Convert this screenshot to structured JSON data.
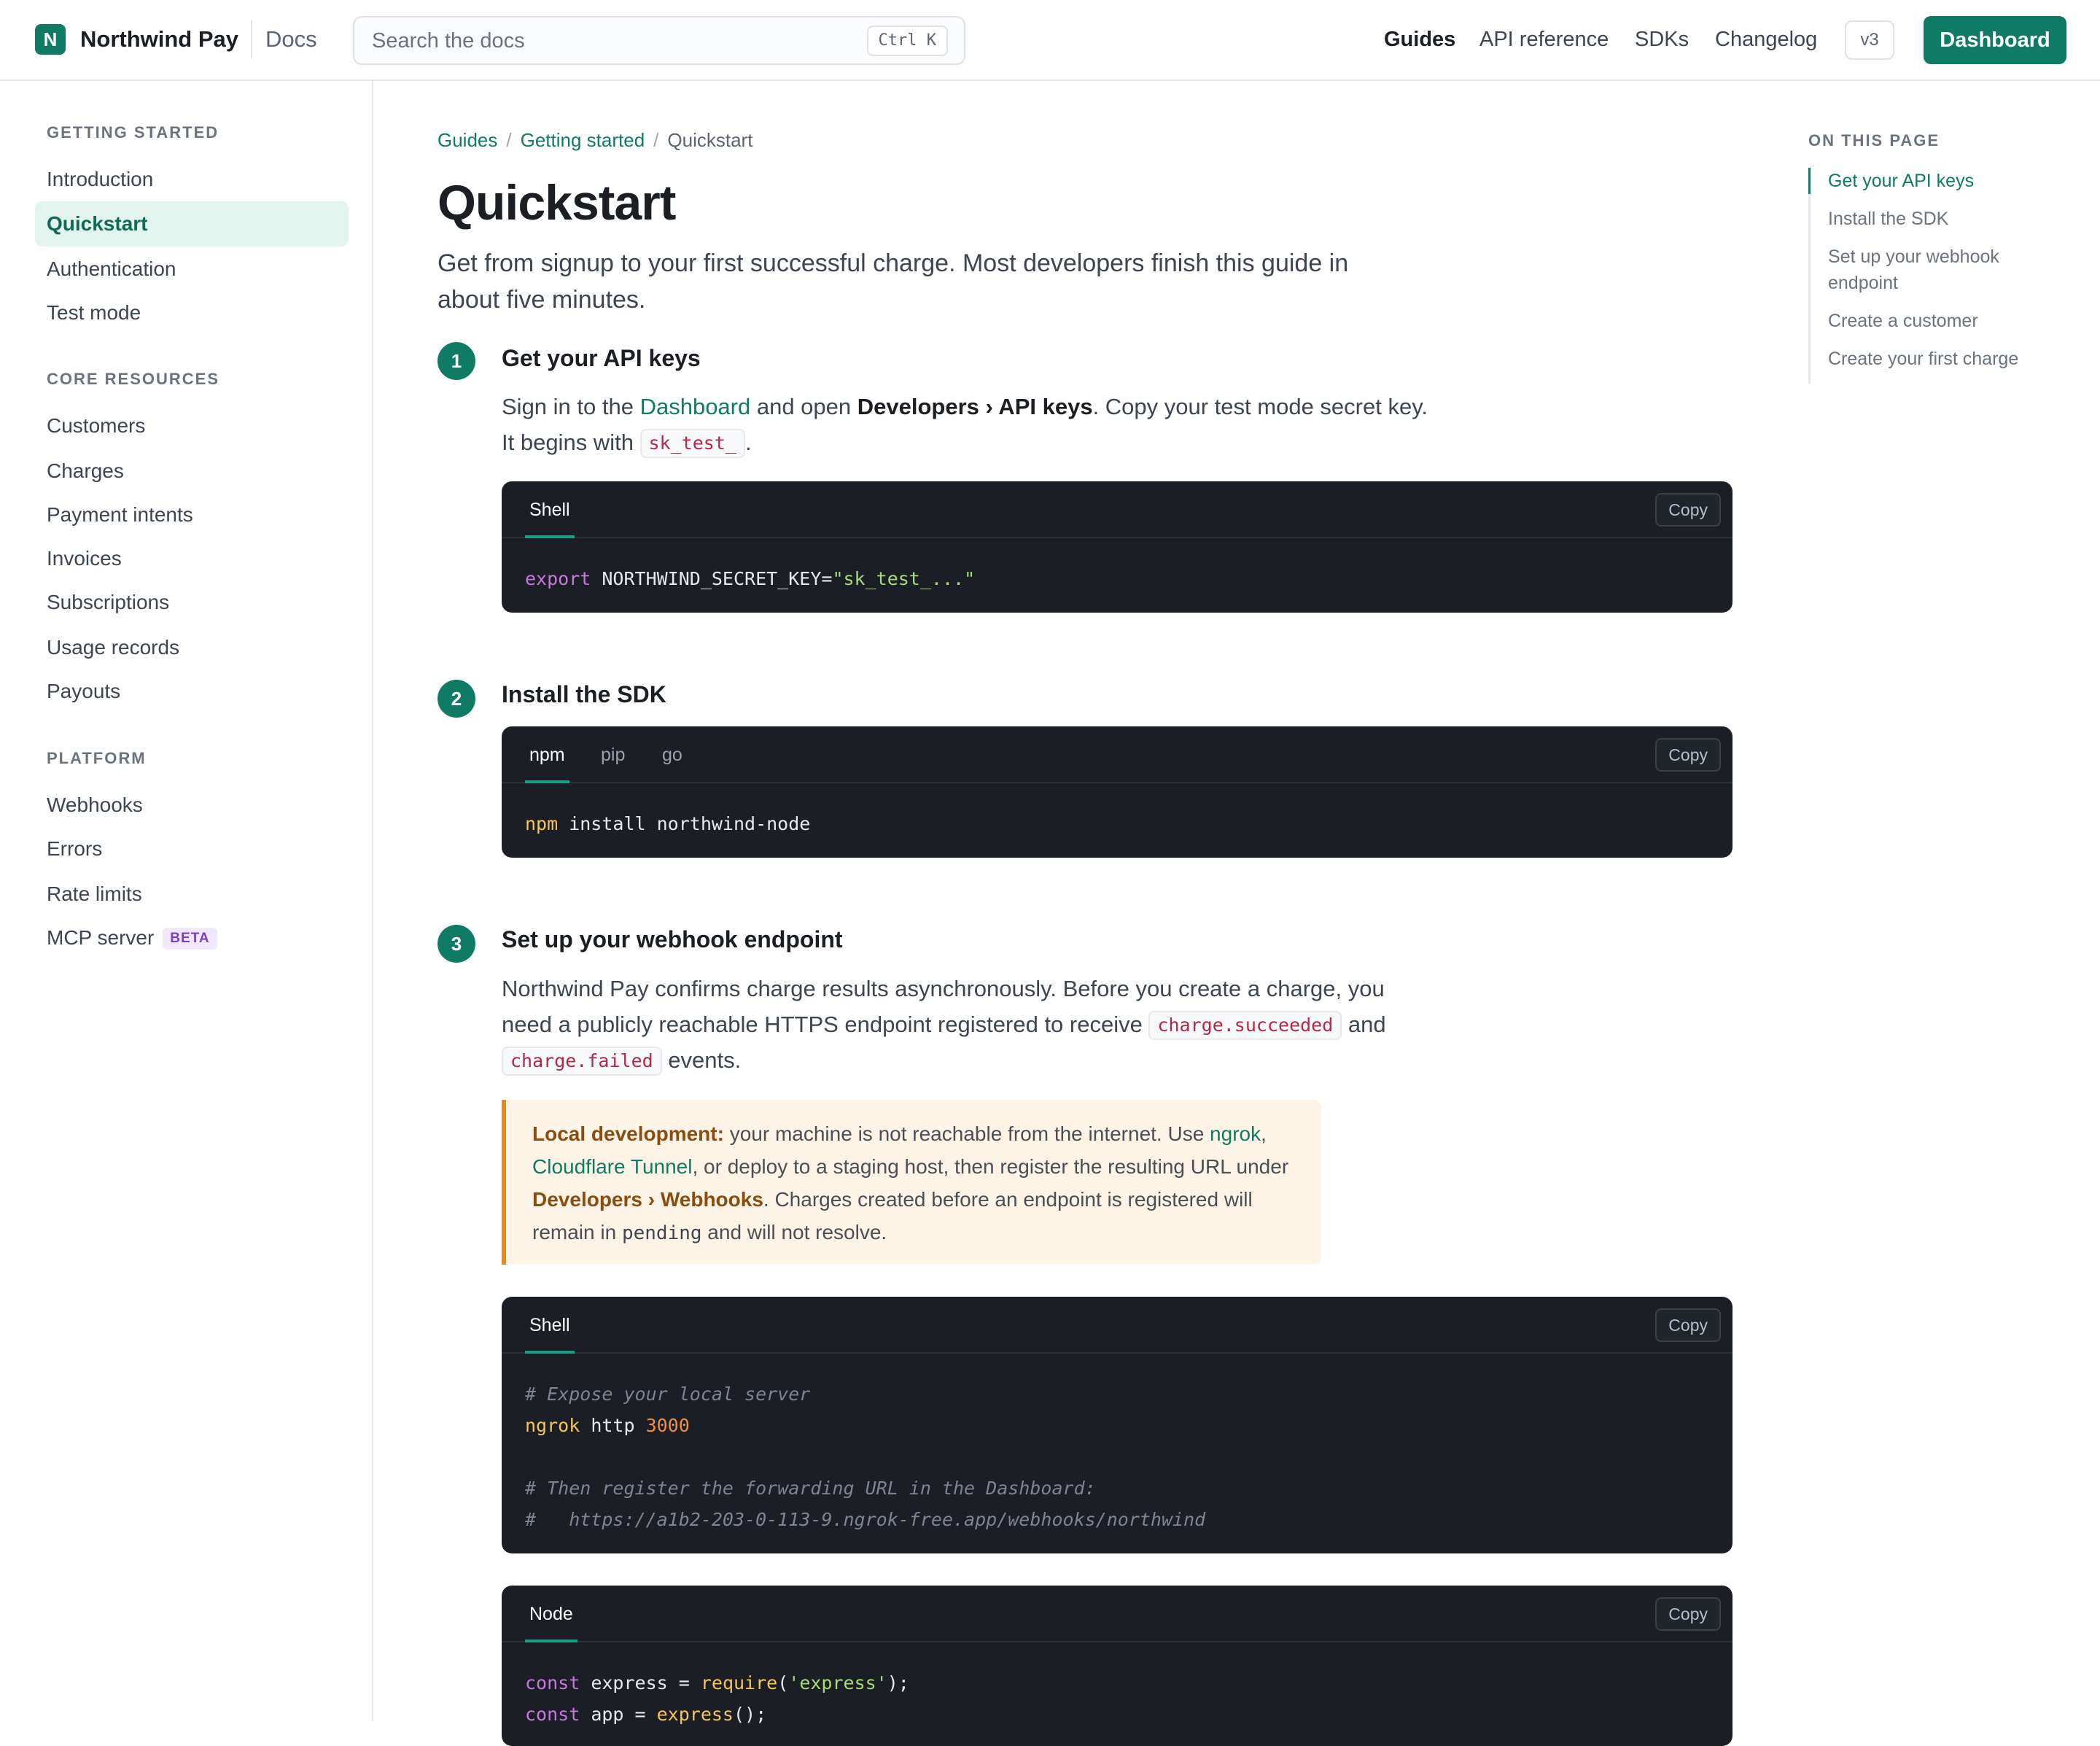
{
  "header": {
    "logo_letter": "N",
    "brand": "Northwind Pay",
    "section": "Docs",
    "search_placeholder": "Search the docs",
    "search_shortcut": "Ctrl K",
    "nav": [
      "Guides",
      "API reference",
      "SDKs",
      "Changelog"
    ],
    "version": "v3",
    "dashboard_button": "Dashboard"
  },
  "sidebar": {
    "sections": [
      {
        "title": "GETTING STARTED",
        "items": [
          "Introduction",
          "Quickstart",
          "Authentication",
          "Test mode"
        ]
      },
      {
        "title": "CORE RESOURCES",
        "items": [
          "Customers",
          "Charges",
          "Payment intents",
          "Invoices",
          "Subscriptions",
          "Usage records",
          "Payouts"
        ]
      },
      {
        "title": "PLATFORM",
        "items": [
          "Webhooks",
          "Errors",
          "Rate limits",
          "MCP server"
        ]
      }
    ],
    "active_item": "Quickstart",
    "beta_badge": "BETA"
  },
  "breadcrumb": [
    "Guides",
    "Getting started",
    "Quickstart"
  ],
  "page": {
    "title": "Quickstart",
    "lead": "Get from signup to your first successful charge. Most developers finish this guide in about five minutes."
  },
  "steps": [
    {
      "number": "1",
      "title": "Get your API keys",
      "body": {
        "t1": "Sign in to the ",
        "link": "Dashboard",
        "t2": " and open ",
        "bold": "Developers › API keys",
        "t3": ". Copy your test mode secret key. It begins with ",
        "code": "sk_test_",
        "t4": "."
      },
      "code_tabs": [
        "Shell"
      ],
      "copy": "Copy",
      "code": {
        "kw": "export",
        "name": " NORTHWIND_SECRET_KEY=",
        "str": "\"sk_test_...\""
      }
    },
    {
      "number": "2",
      "title": "Install the SDK",
      "code_tabs": [
        "npm",
        "pip",
        "go"
      ],
      "copy": "Copy",
      "code": {
        "cmd": "npm",
        "rest": " install northwind-node"
      }
    },
    {
      "number": "3",
      "title": "Set up your webhook endpoint",
      "body": {
        "t1": "Northwind Pay confirms charge results asynchronously. Before you create a charge, you need a publicly reachable HTTPS endpoint registered to receive ",
        "code1": "charge.succeeded",
        "t2": " and ",
        "code2": "charge.failed",
        "t3": " events."
      },
      "callout": {
        "label": "Local development:",
        "t1": " your machine is not reachable from the internet. Use ",
        "link1": "ngrok",
        "t2": ", ",
        "link2": "Cloudflare Tunnel",
        "t3": ", or deploy to a staging host, then register the resulting URL under ",
        "path": "Developers › Webhooks",
        "t4": ". Charges created before an endpoint is registered will remain in ",
        "code": "pending",
        "t5": " and will not resolve."
      },
      "shell": {
        "tab": "Shell",
        "copy": "Copy",
        "comment1": "# Expose your local server",
        "cmd": "ngrok",
        "arg": " http ",
        "port": "3000",
        "comment2": "# Then register the forwarding URL in the Dashboard:",
        "comment3": "#   https://a1b2-203-0-113-9.ngrok-free.app/webhooks/northwind"
      },
      "node": {
        "tab": "Node",
        "copy": "Copy",
        "l1_kw": "const",
        "l1_name": " express = ",
        "l1_fn": "require",
        "l1_open": "(",
        "l1_str": "'express'",
        "l1_close": ");",
        "l2_kw": "const",
        "l2_name": " app = ",
        "l2_fn": "express",
        "l2_close": "();"
      }
    }
  ],
  "toc": {
    "title": "ON THIS PAGE",
    "items": [
      "Get your API keys",
      "Install the SDK",
      "Set up your webhook endpoint",
      "Create a customer",
      "Create your first charge"
    ]
  },
  "colors": {
    "accent": "#0f7b65",
    "code_bg": "#1b1e24",
    "callout_bg": "#fdf3e7",
    "callout_border": "#e38a24"
  }
}
